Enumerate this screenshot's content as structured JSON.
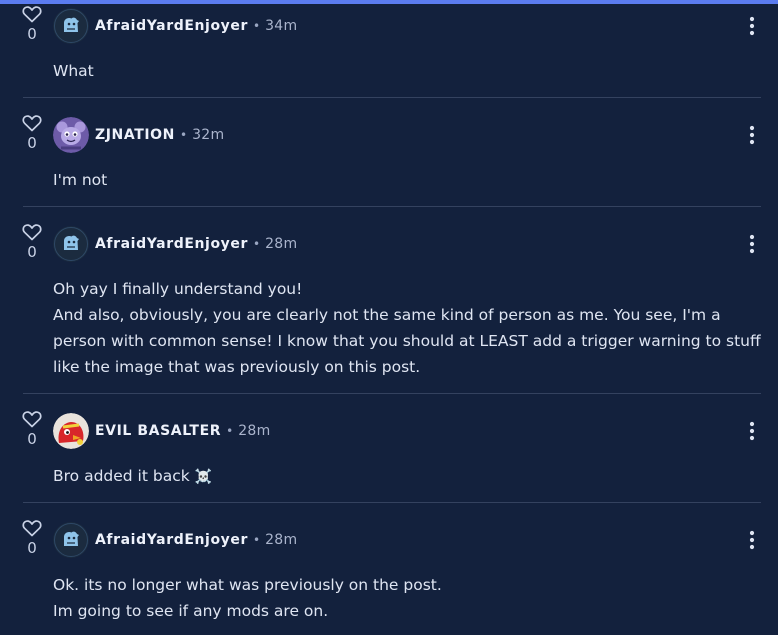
{
  "comments": [
    {
      "author": "AfraidYardEnjoyer",
      "time": "34m",
      "votes": "0",
      "avatar": "blue-ghost-avatar",
      "lines": [
        "What"
      ]
    },
    {
      "author": "ZJNATION",
      "time": "32m",
      "votes": "0",
      "avatar": "purple-critter-avatar",
      "lines": [
        "I'm not"
      ]
    },
    {
      "author": "AfraidYardEnjoyer",
      "time": "28m",
      "votes": "0",
      "avatar": "blue-ghost-avatar",
      "lines": [
        "Oh yay I finally understand you!",
        "And also, obviously, you are clearly not the same kind of person as me. You see, I'm a person with common sense! I know that you should at LEAST add a trigger warning to stuff like the image that was previously on this post."
      ]
    },
    {
      "author": "EVIL BASALTER",
      "time": "28m",
      "votes": "0",
      "avatar": "red-bird-avatar",
      "lines": [
        "Bro added it back"
      ],
      "emoji": "☠️"
    },
    {
      "author": "AfraidYardEnjoyer",
      "time": "28m",
      "votes": "0",
      "avatar": "blue-ghost-avatar",
      "lines": [
        "Ok. its no longer what was previously on the post.",
        "Im going to see if any mods are on."
      ]
    }
  ],
  "separator": "•",
  "colors": {
    "background": "#13213d",
    "accent_bar": "#5b7cf0",
    "divider": "#34425f"
  },
  "icons": {
    "vote": "heart-icon",
    "menu": "more-vertical-icon"
  }
}
